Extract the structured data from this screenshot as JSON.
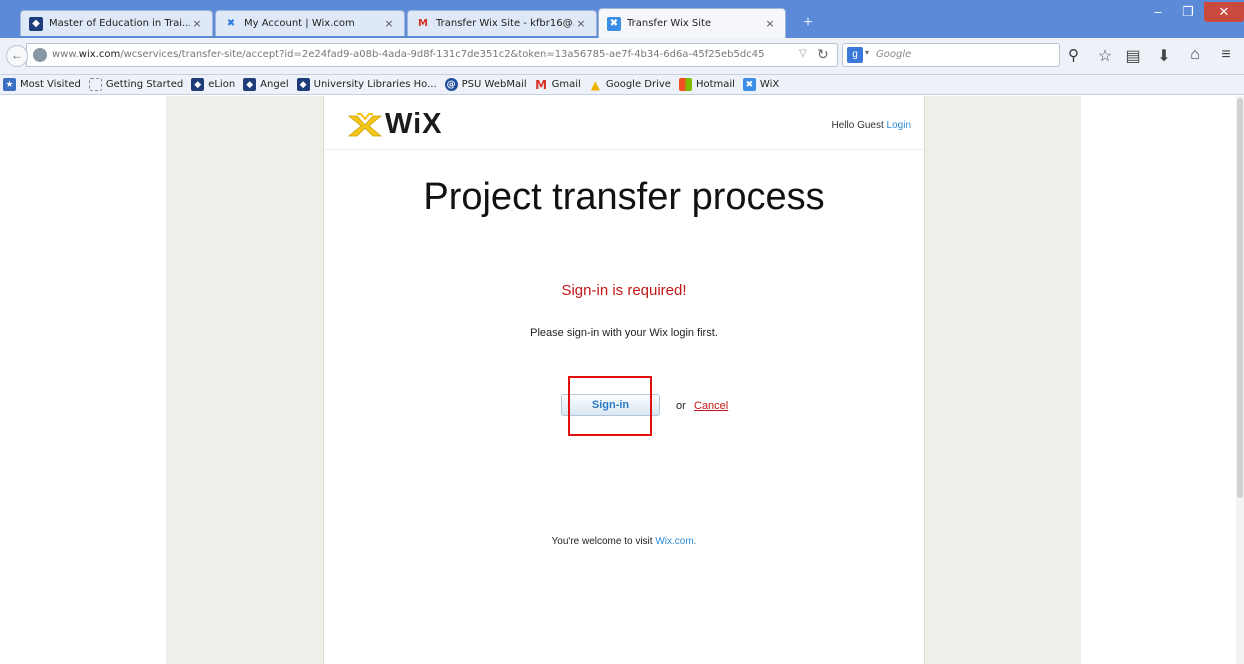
{
  "tabs": [
    {
      "title": "Master of Education in Trai...",
      "icon": "psu-shield-icon"
    },
    {
      "title": "My Account | Wix.com",
      "icon": "wix-icon"
    },
    {
      "title": "Transfer Wix Site - kfbr16@...",
      "icon": "gmail-icon"
    },
    {
      "title": "Transfer Wix Site",
      "icon": "wix-icon",
      "active": true
    }
  ],
  "tab_close_glyph": "×",
  "new_tab_glyph": "+",
  "window": {
    "minimize": "–",
    "restore": "❐",
    "close": "✕"
  },
  "address_bar": {
    "url_prefix": "www.",
    "url_domain": "wix.com",
    "url_path": "/wcservices/transfer-site/accept?id=2e24fad9-a08b-4ada-9d8f-131c7de351c2&token=13a56785-ae7f-4b34-6d6a-45f25eb5dc45"
  },
  "search_bar": {
    "engine_letter": "g",
    "placeholder": "Google"
  },
  "nav_icons": [
    "bookmark-star-icon",
    "reading-list-icon",
    "downloads-icon",
    "home-icon",
    "menu-icon"
  ],
  "bookmarks": [
    {
      "label": "Most Visited",
      "icon": "most-visited-icon"
    },
    {
      "label": "Getting Started",
      "icon": "getting-started-icon"
    },
    {
      "label": "eLion",
      "icon": "psu-shield-icon"
    },
    {
      "label": "Angel",
      "icon": "psu-shield-icon"
    },
    {
      "label": "University Libraries Ho...",
      "icon": "psu-shield-icon"
    },
    {
      "label": "PSU WebMail",
      "icon": "webmail-icon"
    },
    {
      "label": "Gmail",
      "icon": "gmail-icon"
    },
    {
      "label": "Google Drive",
      "icon": "google-drive-icon"
    },
    {
      "label": "Hotmail",
      "icon": "windows-icon"
    },
    {
      "label": "WiX",
      "icon": "wix-icon"
    }
  ],
  "page": {
    "logo_text": "WiX",
    "greeting": "Hello Guest",
    "login_label": "Login",
    "title": "Project transfer process",
    "signin_required": "Sign-in is required!",
    "signin_message": "Please sign-in with your Wix login first.",
    "signin_button": "Sign-in",
    "or_text": "or",
    "cancel_label": "Cancel",
    "visit_text": "You're welcome to visit",
    "wix_link": "Wix.com."
  },
  "colors": {
    "tabbar": "#5a8ad8",
    "page_side": "#efefea",
    "error_red": "#c11717",
    "link_blue": "#2b8ad6",
    "highlight_red": "#e01010"
  }
}
